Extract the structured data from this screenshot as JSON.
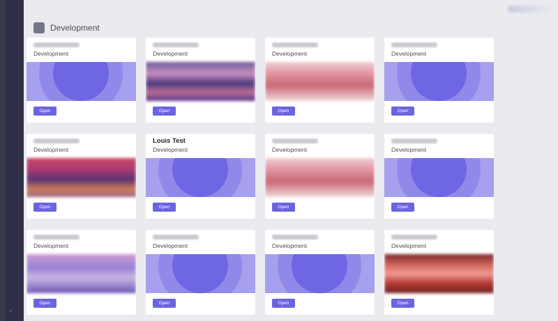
{
  "section": {
    "title": "Development",
    "folder_icon": "folder-icon"
  },
  "cards": [
    {
      "name": "",
      "folder": "Development",
      "banner": "default",
      "open": "Open"
    },
    {
      "name": "",
      "folder": "Development",
      "banner": "p1",
      "open": "Open"
    },
    {
      "name": "",
      "folder": "Development",
      "banner": "p2",
      "open": "Open"
    },
    {
      "name": "",
      "folder": "Development",
      "banner": "default",
      "open": "Open"
    },
    {
      "name": "",
      "folder": "Development",
      "banner": "p3",
      "open": "Open"
    },
    {
      "name": "Louis Test",
      "folder": "Development",
      "banner": "default",
      "open": "Open"
    },
    {
      "name": "",
      "folder": "Development",
      "banner": "p2",
      "open": "Open"
    },
    {
      "name": "",
      "folder": "Development",
      "banner": "default",
      "open": "Open"
    },
    {
      "name": "",
      "folder": "Development",
      "banner": "p4",
      "open": "Open"
    },
    {
      "name": "",
      "folder": "Development",
      "banner": "default",
      "open": "Open"
    },
    {
      "name": "",
      "folder": "Development",
      "banner": "default",
      "open": "Open"
    },
    {
      "name": "",
      "folder": "Development",
      "banner": "p5",
      "open": "Open"
    }
  ],
  "colors": {
    "accent": "#6b63e0",
    "sidebar": "#2f2f48",
    "background": "#ebebef"
  }
}
